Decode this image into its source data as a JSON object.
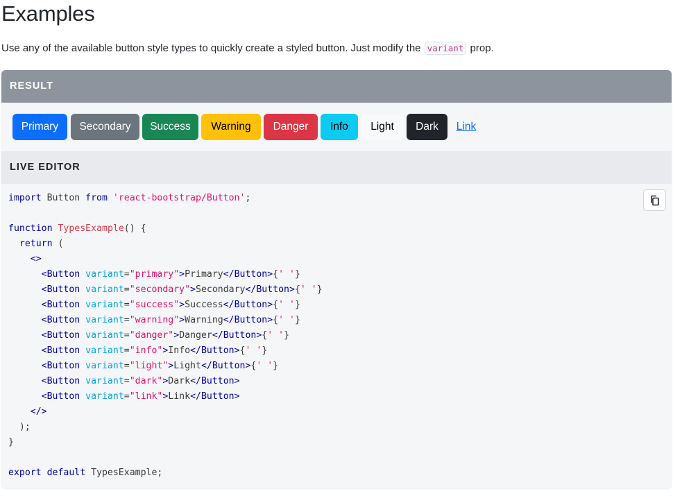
{
  "page": {
    "title": "Examples",
    "intro_before": "Use any of the available button style types to quickly create a styled button. Just modify the ",
    "intro_code": "variant",
    "intro_after": " prop."
  },
  "result": {
    "header": "RESULT",
    "buttons": [
      {
        "label": "Primary",
        "variant": "primary",
        "color": "#0d6efd"
      },
      {
        "label": "Secondary",
        "variant": "secondary",
        "color": "#6c757d"
      },
      {
        "label": "Success",
        "variant": "success",
        "color": "#198754"
      },
      {
        "label": "Warning",
        "variant": "warning",
        "color": "#ffc107"
      },
      {
        "label": "Danger",
        "variant": "danger",
        "color": "#dc3545"
      },
      {
        "label": "Info",
        "variant": "info",
        "color": "#0dcaf0"
      },
      {
        "label": "Light",
        "variant": "light",
        "color": "#f8f9fa"
      },
      {
        "label": "Dark",
        "variant": "dark",
        "color": "#212529"
      },
      {
        "label": "Link",
        "variant": "link",
        "color": "#0d6efd"
      }
    ]
  },
  "editor": {
    "header": "LIVE EDITOR",
    "copy_icon": "copy-icon",
    "code_lines": [
      [
        [
          "kw",
          "import"
        ],
        [
          "plain",
          " Button "
        ],
        [
          "kw",
          "from"
        ],
        [
          "plain",
          " "
        ],
        [
          "str",
          "'react-bootstrap/Button'"
        ],
        [
          "punc",
          ";"
        ]
      ],
      [],
      [
        [
          "kw",
          "function"
        ],
        [
          "plain",
          " "
        ],
        [
          "fn",
          "TypesExample"
        ],
        [
          "punc",
          "() {"
        ]
      ],
      [
        [
          "plain",
          "  "
        ],
        [
          "kw",
          "return"
        ],
        [
          "punc",
          " ("
        ]
      ],
      [
        [
          "plain",
          "    "
        ],
        [
          "tag",
          "<>"
        ]
      ],
      [
        [
          "plain",
          "      "
        ],
        [
          "tag",
          "<Button"
        ],
        [
          "plain",
          " "
        ],
        [
          "attr",
          "variant"
        ],
        [
          "punc",
          "="
        ],
        [
          "str",
          "\"primary\""
        ],
        [
          "tag",
          ">"
        ],
        [
          "plain",
          "Primary"
        ],
        [
          "tag",
          "</Button>"
        ],
        [
          "punc",
          "{"
        ],
        [
          "str",
          "' '"
        ],
        [
          "punc",
          "}"
        ]
      ],
      [
        [
          "plain",
          "      "
        ],
        [
          "tag",
          "<Button"
        ],
        [
          "plain",
          " "
        ],
        [
          "attr",
          "variant"
        ],
        [
          "punc",
          "="
        ],
        [
          "str",
          "\"secondary\""
        ],
        [
          "tag",
          ">"
        ],
        [
          "plain",
          "Secondary"
        ],
        [
          "tag",
          "</Button>"
        ],
        [
          "punc",
          "{"
        ],
        [
          "str",
          "' '"
        ],
        [
          "punc",
          "}"
        ]
      ],
      [
        [
          "plain",
          "      "
        ],
        [
          "tag",
          "<Button"
        ],
        [
          "plain",
          " "
        ],
        [
          "attr",
          "variant"
        ],
        [
          "punc",
          "="
        ],
        [
          "str",
          "\"success\""
        ],
        [
          "tag",
          ">"
        ],
        [
          "plain",
          "Success"
        ],
        [
          "tag",
          "</Button>"
        ],
        [
          "punc",
          "{"
        ],
        [
          "str",
          "' '"
        ],
        [
          "punc",
          "}"
        ]
      ],
      [
        [
          "plain",
          "      "
        ],
        [
          "tag",
          "<Button"
        ],
        [
          "plain",
          " "
        ],
        [
          "attr",
          "variant"
        ],
        [
          "punc",
          "="
        ],
        [
          "str",
          "\"warning\""
        ],
        [
          "tag",
          ">"
        ],
        [
          "plain",
          "Warning"
        ],
        [
          "tag",
          "</Button>"
        ],
        [
          "punc",
          "{"
        ],
        [
          "str",
          "' '"
        ],
        [
          "punc",
          "}"
        ]
      ],
      [
        [
          "plain",
          "      "
        ],
        [
          "tag",
          "<Button"
        ],
        [
          "plain",
          " "
        ],
        [
          "attr",
          "variant"
        ],
        [
          "punc",
          "="
        ],
        [
          "str",
          "\"danger\""
        ],
        [
          "tag",
          ">"
        ],
        [
          "plain",
          "Danger"
        ],
        [
          "tag",
          "</Button>"
        ],
        [
          "punc",
          "{"
        ],
        [
          "str",
          "' '"
        ],
        [
          "punc",
          "}"
        ]
      ],
      [
        [
          "plain",
          "      "
        ],
        [
          "tag",
          "<Button"
        ],
        [
          "plain",
          " "
        ],
        [
          "attr",
          "variant"
        ],
        [
          "punc",
          "="
        ],
        [
          "str",
          "\"info\""
        ],
        [
          "tag",
          ">"
        ],
        [
          "plain",
          "Info"
        ],
        [
          "tag",
          "</Button>"
        ],
        [
          "punc",
          "{"
        ],
        [
          "str",
          "' '"
        ],
        [
          "punc",
          "}"
        ]
      ],
      [
        [
          "plain",
          "      "
        ],
        [
          "tag",
          "<Button"
        ],
        [
          "plain",
          " "
        ],
        [
          "attr",
          "variant"
        ],
        [
          "punc",
          "="
        ],
        [
          "str",
          "\"light\""
        ],
        [
          "tag",
          ">"
        ],
        [
          "plain",
          "Light"
        ],
        [
          "tag",
          "</Button>"
        ],
        [
          "punc",
          "{"
        ],
        [
          "str",
          "' '"
        ],
        [
          "punc",
          "}"
        ]
      ],
      [
        [
          "plain",
          "      "
        ],
        [
          "tag",
          "<Button"
        ],
        [
          "plain",
          " "
        ],
        [
          "attr",
          "variant"
        ],
        [
          "punc",
          "="
        ],
        [
          "str",
          "\"dark\""
        ],
        [
          "tag",
          ">"
        ],
        [
          "plain",
          "Dark"
        ],
        [
          "tag",
          "</Button>"
        ]
      ],
      [
        [
          "plain",
          "      "
        ],
        [
          "tag",
          "<Button"
        ],
        [
          "plain",
          " "
        ],
        [
          "attr",
          "variant"
        ],
        [
          "punc",
          "="
        ],
        [
          "str",
          "\"link\""
        ],
        [
          "tag",
          ">"
        ],
        [
          "plain",
          "Link"
        ],
        [
          "tag",
          "</Button>"
        ]
      ],
      [
        [
          "plain",
          "    "
        ],
        [
          "tag",
          "</>"
        ]
      ],
      [
        [
          "plain",
          "  "
        ],
        [
          "punc",
          ");"
        ]
      ],
      [
        [
          "punc",
          "}"
        ]
      ],
      [],
      [
        [
          "kw",
          "export"
        ],
        [
          "plain",
          " "
        ],
        [
          "kw",
          "default"
        ],
        [
          "plain",
          " TypesExample"
        ],
        [
          "punc",
          ";"
        ]
      ]
    ]
  }
}
